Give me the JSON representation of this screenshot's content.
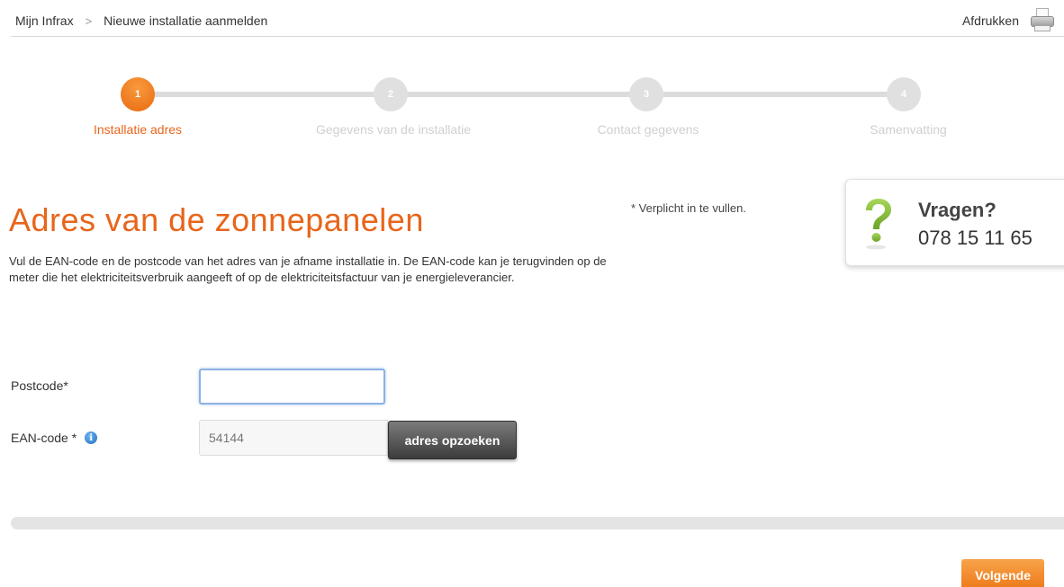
{
  "breadcrumb": {
    "home": "Mijn Infrax",
    "separator": ">",
    "current": "Nieuwe installatie aanmelden"
  },
  "print": {
    "label": "Afdrukken",
    "icon": "printer-icon"
  },
  "stepper": {
    "steps": [
      {
        "number": "1",
        "label": "Installatie adres",
        "active": true
      },
      {
        "number": "2",
        "label": "Gegevens van de installatie",
        "active": false
      },
      {
        "number": "3",
        "label": "Contact gegevens",
        "active": false
      },
      {
        "number": "4",
        "label": "Samenvatting",
        "active": false
      }
    ]
  },
  "main": {
    "title": "Adres van de zonnepanelen",
    "intro": "Vul de EAN-code en de postcode van het adres van je afname installatie in. De EAN-code kan je terugvinden op de meter die het elektriciteitsverbruik aangeeft of op de elektriciteitsfactuur van je energieleverancier.",
    "required_note": "* Verplicht in te vullen."
  },
  "help": {
    "title": "Vragen?",
    "phone": "078 15 11 65",
    "icon": "question-mark-icon"
  },
  "form": {
    "postcode_label": "Postcode*",
    "postcode_value": "",
    "ean_label": "EAN-code *",
    "ean_value": "54144",
    "info_icon": "info-icon",
    "lookup_button": "adres opzoeken"
  },
  "footer": {
    "next_button": "Volgende"
  },
  "colors": {
    "accent": "#e8651a",
    "help_icon": "#8dc63f",
    "step_inactive": "#e0e0e0"
  }
}
